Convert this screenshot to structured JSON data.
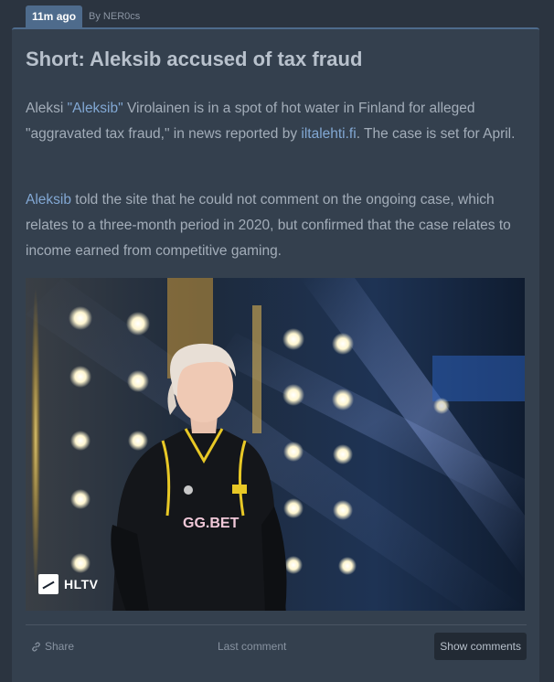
{
  "post": {
    "time_ago": "11m ago",
    "author": "By NER0cs",
    "title": "Short: Aleksib accused of tax fraud",
    "paragraph1": {
      "part1": "Aleksi ",
      "link1": "\"Aleksib\"",
      "part2": " Virolainen is in a spot of hot water in Finland for alleged \"aggravated tax fraud,\" in news reported by ",
      "link2": "iltalehti.fi",
      "part3": ". The case is set for April."
    },
    "paragraph2": {
      "link1": "Aleksib",
      "part1": " told the site that he could not comment on the ongoing case, which relates to a three-month period in 2020, but confirmed that the case relates to income earned from competitive gaming."
    },
    "photo": {
      "watermark": "HLTV",
      "jersey_sponsor": "GG.BET"
    }
  },
  "footer": {
    "share_label": "Share",
    "last_comment_label": "Last comment",
    "show_comments_label": "Show comments"
  },
  "colors": {
    "background": "#2b3440",
    "card": "#34404e",
    "accent": "#4e6b8c",
    "link": "#82a8d4"
  },
  "icons": {
    "share": "link-icon",
    "watermark": "hltv-logo"
  }
}
